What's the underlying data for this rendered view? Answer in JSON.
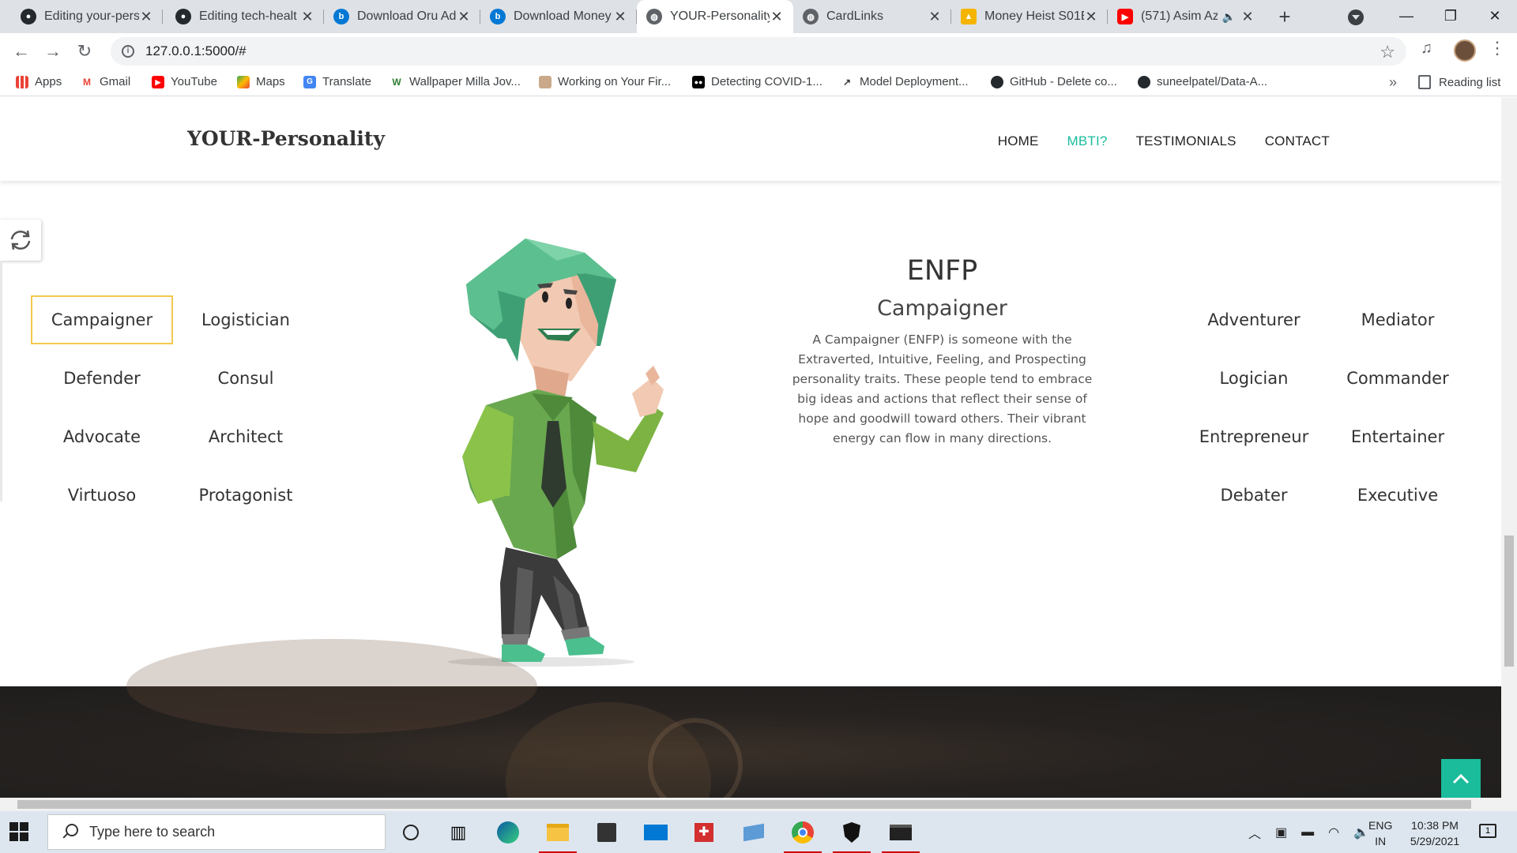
{
  "browser": {
    "tabs": [
      {
        "title": "Editing your-pers",
        "favicon": "github-icon"
      },
      {
        "title": "Editing tech-healt",
        "favicon": "github-icon"
      },
      {
        "title": "Download Oru Ad",
        "favicon": "bing-icon"
      },
      {
        "title": "Download Money",
        "favicon": "bing-icon"
      },
      {
        "title": "YOUR-Personality",
        "favicon": "globe-icon",
        "active": true
      },
      {
        "title": "CardLinks",
        "favicon": "globe-icon"
      },
      {
        "title": "Money Heist S01E",
        "favicon": "drive-icon"
      },
      {
        "title": "(571) Asim Az",
        "favicon": "youtube-icon",
        "audio": true
      }
    ],
    "url": "127.0.0.1:5000/#",
    "bookmarks": [
      {
        "label": "Apps",
        "icon": "apps-grid-icon"
      },
      {
        "label": "Gmail",
        "icon": "gmail-icon"
      },
      {
        "label": "YouTube",
        "icon": "youtube-icon"
      },
      {
        "label": "Maps",
        "icon": "maps-icon"
      },
      {
        "label": "Translate",
        "icon": "translate-icon"
      },
      {
        "label": "Wallpaper Milla Jov...",
        "icon": "w-icon"
      },
      {
        "label": "Working on Your Fir...",
        "icon": "person-icon"
      },
      {
        "label": "Detecting COVID-1...",
        "icon": "medium-icon"
      },
      {
        "label": "Model Deployment...",
        "icon": "chart-icon"
      },
      {
        "label": "GitHub - Delete co...",
        "icon": "github-icon"
      },
      {
        "label": "suneelpatel/Data-A...",
        "icon": "github-icon"
      }
    ],
    "bookmarks_more": "»",
    "reading_list": "Reading list"
  },
  "site": {
    "brand": "YOUR-Personality",
    "nav": [
      "HOME",
      "MBTI?",
      "TESTIMONIALS",
      "CONTACT"
    ],
    "active_nav": "MBTI?",
    "accent_color": "#1abc9c",
    "left_types": [
      "Campaigner",
      "Logistician",
      "Defender",
      "Consul",
      "Advocate",
      "Architect",
      "Virtuoso",
      "Protagonist"
    ],
    "right_types": [
      "Adventurer",
      "Mediator",
      "Logician",
      "Commander",
      "Entrepreneur",
      "Entertainer",
      "Debater",
      "Executive"
    ],
    "selected_type": "Campaigner",
    "selected_border_color": "#f2c94c",
    "detail": {
      "code": "ENFP",
      "name": "Campaigner",
      "description": "A Campaigner (ENFP) is someone with the Extraverted, Intuitive, Feeling, and Prospecting personality traits. These people tend to embrace big ideas and actions that reflect their sense of hope and goodwill toward others. Their vibrant energy can flow in many directions."
    }
  },
  "taskbar": {
    "search_placeholder": "Type here to search",
    "lang_top": "ENG",
    "lang_bottom": "IN",
    "time": "10:38 PM",
    "date": "5/29/2021",
    "notification_count": "1"
  }
}
